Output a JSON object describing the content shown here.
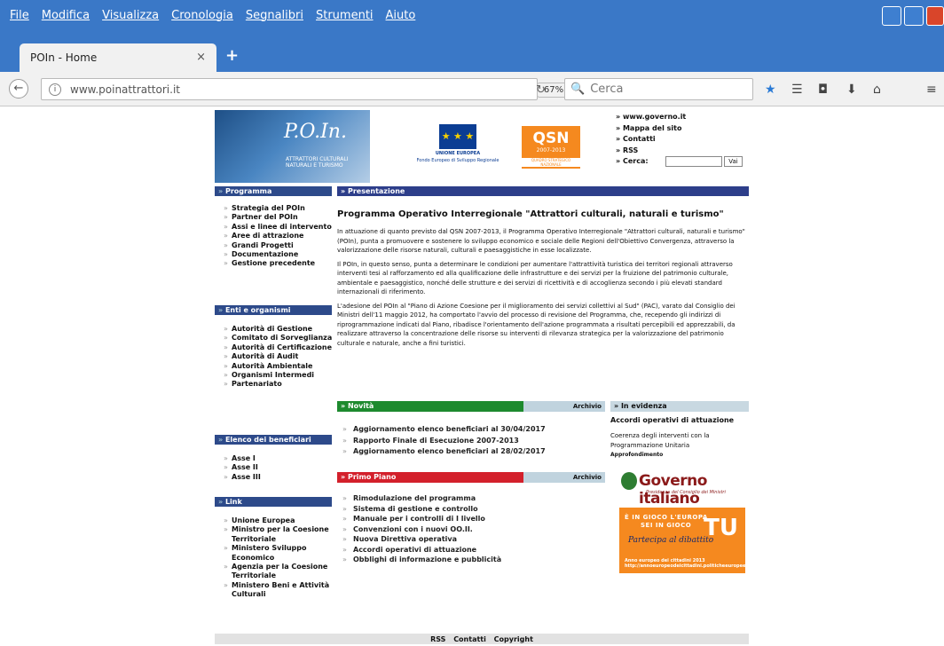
{
  "browser": {
    "menu": [
      "File",
      "Modifica",
      "Visualizza",
      "Cronologia",
      "Segnalibri",
      "Strumenti",
      "Aiuto"
    ],
    "tab_title": "POIn - Home",
    "tab_close": "×",
    "new_tab": "+",
    "url": "www.poinattrattori.it",
    "zoom": "67%",
    "search_placeholder": "Cerca"
  },
  "header": {
    "logo_text": "P.O.In.",
    "logo_sub": "ATTRATTORI CULTURALI NATURALI E TURISMO",
    "eu_label": "UNIONE EUROPEA",
    "eu_sub": "Fondo Europeo di Sviluppo Regionale",
    "qsn_label": "QSN",
    "qsn_years": "2007-2013",
    "qsn_sub": "QUADRO STRATEGICO NAZIONALE",
    "links": [
      "www.governo.it",
      "Mappa del sito",
      "Contatti",
      "RSS"
    ],
    "cerca_label": "Cerca:",
    "vai_label": "Vai"
  },
  "sidebar": {
    "programma": {
      "title": "Programma",
      "items": [
        "Strategia del POIn",
        "Partner del POIn",
        "Assi e linee di intervento",
        "Aree di attrazione",
        "Grandi Progetti",
        "Documentazione",
        "Gestione precedente"
      ]
    },
    "enti": {
      "title": "Enti e organismi",
      "items": [
        "Autorità di Gestione",
        "Comitato di Sorveglianza",
        "Autorità di Certificazione",
        "Autorità di Audit",
        "Autorità Ambientale",
        "Organismi Intermedi",
        "Partenariato"
      ]
    },
    "beneficiari": {
      "title": "Elenco dei beneficiari",
      "items": [
        "Asse I",
        "Asse II",
        "Asse III"
      ]
    },
    "link": {
      "title": "Link",
      "items": [
        "Unione Europea",
        "Ministro per la Coesione Territoriale",
        "Ministero Sviluppo Economico",
        "Agenzia per la Coesione Territoriale",
        "Ministero Beni e Attività Culturali"
      ]
    }
  },
  "main": {
    "section_label": "Presentazione",
    "title": "Programma Operativo Interregionale \"Attrattori culturali, naturali e turismo\"",
    "paragraphs": [
      "In attuazione di quanto previsto dal QSN 2007-2013, il Programma Operativo Interregionale \"Attrattori culturali, naturali e turismo\" (POIn), punta a promuovere e sostenere lo sviluppo economico e sociale delle Regioni dell'Obiettivo Convergenza, attraverso la valorizzazione delle risorse naturali, culturali e paesaggistiche in esse localizzate.",
      "Il POIn, in questo senso, punta a determinare le condizioni per aumentare l'attrattività turistica dei territori regionali attraverso interventi tesi al rafforzamento ed alla qualificazione delle infrastrutture e dei servizi per la fruizione del patrimonio culturale, ambientale e paesaggistico, nonché delle strutture e dei servizi di ricettività e di accoglienza secondo i più elevati standard internazionali di riferimento.",
      "L'adesione del POIn al \"Piano di Azione Coesione per il miglioramento dei servizi collettivi al Sud\" (PAC), varato dal Consiglio dei Ministri dell'11 maggio 2012, ha comportato l'avvio del processo di revisione del Programma, che, recependo gli indirizzi di riprogrammazione indicati dal Piano, ribadisce l'orientamento dell'azione programmata a risultati percepibili ed apprezzabili, da realizzare attraverso la concentrazione delle risorse su interventi di rilevanza strategica per la valorizzazione del patrimonio culturale e naturale, anche a fini turistici."
    ],
    "novita": {
      "title": "Novità",
      "archive": "Archivio",
      "items": [
        "Aggiornamento elenco beneficiari al 30/04/2017",
        "Rapporto Finale di Esecuzione 2007-2013",
        "Aggiornamento elenco beneficiari al 28/02/2017"
      ]
    },
    "primo_piano": {
      "title": "Primo Piano",
      "archive": "Archivio",
      "items": [
        "Rimodulazione del programma",
        "Sistema di gestione e controllo",
        "Manuale per i controlli di I livello",
        "Convenzioni con i nuovi OO.II.",
        "Nuova Direttiva operativa",
        "Accordi operativi di attuazione",
        "Obblighi di informazione e pubblicità"
      ]
    },
    "evidenza": {
      "title": "In evidenza",
      "headline": "Accordi operativi di attuazione",
      "text": "Coerenza degli interventi con la Programmazione Unitaria",
      "more": "Approfondimento"
    },
    "governo_banner": {
      "title": "Governo italiano",
      "sub": "Presidenza del Consiglio dei Ministri"
    },
    "europa_banner": {
      "line1": "È IN GIOCO L'EUROPA",
      "line2": "SEI IN GIOCO",
      "tu": "TU",
      "handwritten": "Partecipa al dibattito",
      "footer1": "Anno europeo dei cittadini 2013",
      "footer2": "http://annoeuropeodeicittadini.politicheeuropee.it/"
    }
  },
  "footer": {
    "links": [
      "RSS",
      "Contatti",
      "Copyright"
    ]
  }
}
